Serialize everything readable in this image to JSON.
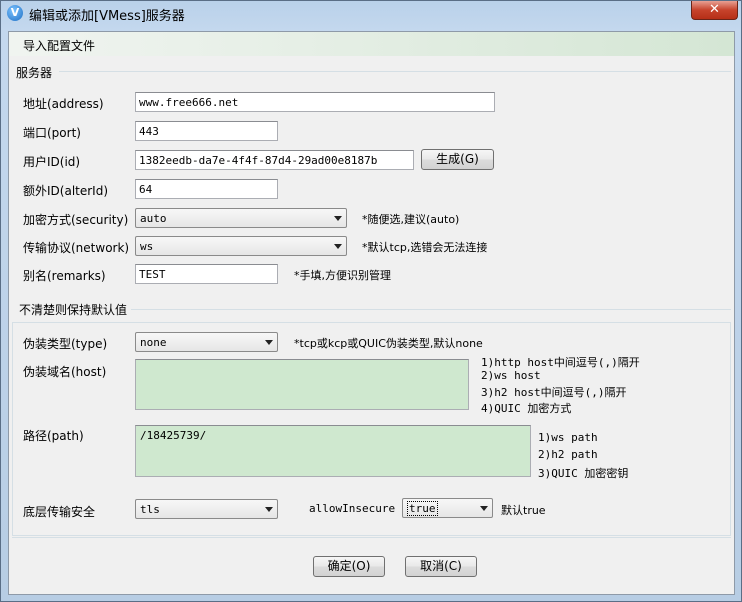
{
  "window": {
    "title": "编辑或添加[VMess]服务器",
    "close_glyph": "✕"
  },
  "menu": {
    "import_label": "导入配置文件"
  },
  "server_section": {
    "label": "服务器",
    "address": {
      "label": "地址(address)",
      "value": "www.free666.net"
    },
    "port": {
      "label": "端口(port)",
      "value": "443"
    },
    "user_id": {
      "label": "用户ID(id)",
      "value": "1382eedb-da7e-4f4f-87d4-29ad00e8187b",
      "generate_label": "生成(G)"
    },
    "alter_id": {
      "label": "额外ID(alterId)",
      "value": "64"
    },
    "security": {
      "label": "加密方式(security)",
      "value": "auto",
      "hint": "*随便选,建议(auto)"
    },
    "network": {
      "label": "传输协议(network)",
      "value": "ws",
      "hint": "*默认tcp,选错会无法连接"
    },
    "remarks": {
      "label": "别名(remarks)",
      "value": "TEST",
      "hint": "*手填,方便识别管理"
    }
  },
  "advanced_section": {
    "label": "不清楚则保持默认值",
    "type": {
      "label": "伪装类型(type)",
      "value": "none",
      "hint": "*tcp或kcp或QUIC伪装类型,默认none"
    },
    "host": {
      "label": "伪装域名(host)",
      "value": "",
      "hints": [
        "1)http host中间逗号(,)隔开",
        "2)ws host",
        "3)h2 host中间逗号(,)隔开",
        "4)QUIC 加密方式"
      ]
    },
    "path": {
      "label": "路径(path)",
      "value": "/18425739/",
      "hints": [
        "1)ws path",
        "2)h2 path",
        "3)QUIC 加密密钥"
      ]
    },
    "stream_security": {
      "label": "底层传输安全",
      "value": "tls"
    },
    "allow_insecure": {
      "label": "allowInsecure",
      "value": "true",
      "hint": "默认true"
    }
  },
  "buttons": {
    "ok_label": "确定(O)",
    "cancel_label": "取消(C)"
  },
  "colors": {
    "textarea_bg": "#cfe8cf",
    "close_red": "#c7432c"
  }
}
